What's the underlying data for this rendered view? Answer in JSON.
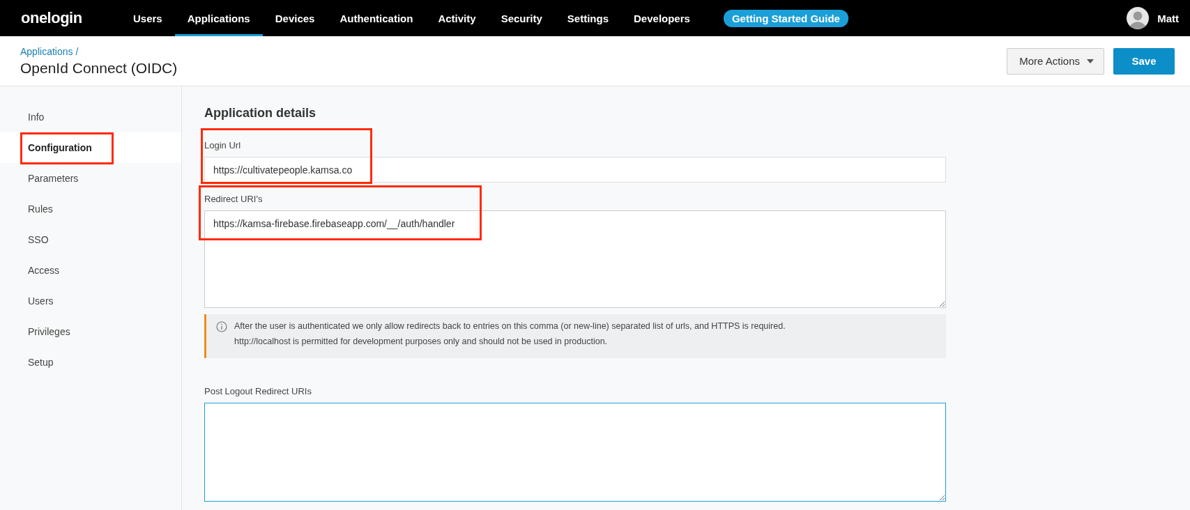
{
  "topbar": {
    "logo": "onelogin",
    "nav": [
      {
        "label": "Users",
        "selected": false
      },
      {
        "label": "Applications",
        "selected": true
      },
      {
        "label": "Devices",
        "selected": false
      },
      {
        "label": "Authentication",
        "selected": false
      },
      {
        "label": "Activity",
        "selected": false
      },
      {
        "label": "Security",
        "selected": false
      },
      {
        "label": "Settings",
        "selected": false
      },
      {
        "label": "Developers",
        "selected": false
      }
    ],
    "guide_button": "Getting Started Guide",
    "user": "Matt"
  },
  "header": {
    "breadcrumb": "Applications /",
    "title": "OpenId Connect (OIDC)",
    "more_actions": "More Actions",
    "save": "Save"
  },
  "sidebar": {
    "items": [
      {
        "label": "Info",
        "selected": false,
        "highlighted": false
      },
      {
        "label": "Configuration",
        "selected": true,
        "highlighted": true
      },
      {
        "label": "Parameters",
        "selected": false,
        "highlighted": false
      },
      {
        "label": "Rules",
        "selected": false,
        "highlighted": false
      },
      {
        "label": "SSO",
        "selected": false,
        "highlighted": false
      },
      {
        "label": "Access",
        "selected": false,
        "highlighted": false
      },
      {
        "label": "Users",
        "selected": false,
        "highlighted": false
      },
      {
        "label": "Privileges",
        "selected": false,
        "highlighted": false
      },
      {
        "label": "Setup",
        "selected": false,
        "highlighted": false
      }
    ]
  },
  "section": {
    "title": "Application details",
    "fields": [
      {
        "kind": "input",
        "label": "Login Url",
        "value": "https://cultivatepeople.kamsa.co",
        "highlighted": true
      },
      {
        "kind": "textarea",
        "label": "Redirect URI's",
        "value": "https://kamsa-firebase.firebaseapp.com/__/auth/handler",
        "highlighted": true,
        "note": [
          "After the user is authenticated we only allow redirects back to entries on this comma (or new-line) separated list of urls, and HTTPS is required.",
          "http://localhost is permitted for development purposes only and should not be used in production."
        ]
      },
      {
        "kind": "textarea",
        "label": "Post Logout Redirect URIs",
        "highlighted": false,
        "focused": true
      }
    ]
  }
}
